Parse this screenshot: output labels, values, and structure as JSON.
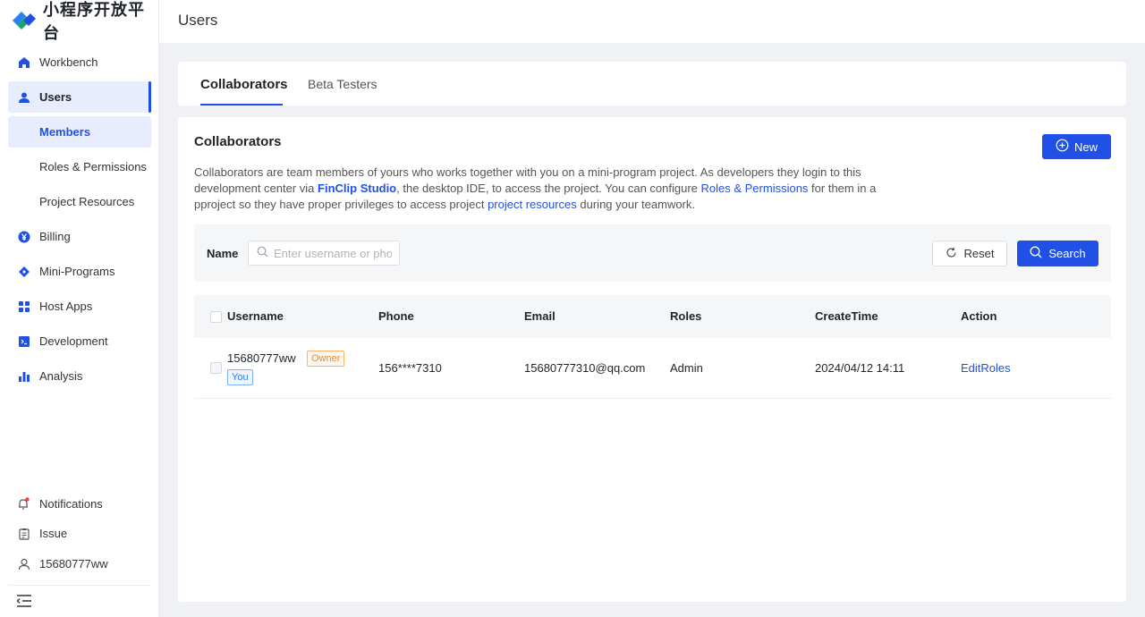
{
  "app": {
    "logo_text": "小程序开放平台"
  },
  "sidebar": {
    "items": [
      {
        "label": "Workbench",
        "icon": "home-icon"
      },
      {
        "label": "Users",
        "icon": "user-icon"
      },
      {
        "label": "Members"
      },
      {
        "label": "Roles & Permissions"
      },
      {
        "label": "Project Resources"
      },
      {
        "label": "Billing",
        "icon": "yen-icon"
      },
      {
        "label": "Mini-Programs",
        "icon": "diamond-icon"
      },
      {
        "label": "Host Apps",
        "icon": "grid-icon"
      },
      {
        "label": "Development",
        "icon": "terminal-icon"
      },
      {
        "label": "Analysis",
        "icon": "bar-chart-icon"
      }
    ],
    "bottom": [
      {
        "label": "Notifications",
        "icon": "bell-icon"
      },
      {
        "label": "Issue",
        "icon": "clipboard-icon"
      },
      {
        "label": "15680777ww",
        "icon": "person-icon"
      }
    ]
  },
  "header": {
    "title": "Users"
  },
  "tabs": [
    {
      "label": "Collaborators"
    },
    {
      "label": "Beta Testers"
    }
  ],
  "section": {
    "title": "Collaborators",
    "new_label": "New",
    "desc": {
      "p1": "Collaborators are team members of yours who works together with you on a mini-program project. As developers they login to this development center via ",
      "link1": "FinClip Studio",
      "p2": ", the desktop IDE, to access the project. You can configure ",
      "link2": "Roles & Permissions",
      "p3": " for them in a pproject so they have proper privileges to access project ",
      "link3": "project resources",
      "p4": " during your teamwork."
    }
  },
  "filter": {
    "label": "Name",
    "placeholder": "Enter username or phone",
    "reset_label": "Reset",
    "search_label": "Search"
  },
  "table": {
    "columns": [
      "Username",
      "Phone",
      "Email",
      "Roles",
      "CreateTime",
      "Action"
    ],
    "rows": [
      {
        "username": "15680777ww",
        "owner_badge": "Owner",
        "you_badge": "You",
        "phone": "156****7310",
        "email": "15680777310@qq.com",
        "roles": "Admin",
        "create_time": "2024/04/12 14:11",
        "action": "EditRoles"
      }
    ]
  },
  "colors": {
    "primary": "#2150e6",
    "owner": "#f08c1c",
    "you": "#2f7cf6"
  }
}
